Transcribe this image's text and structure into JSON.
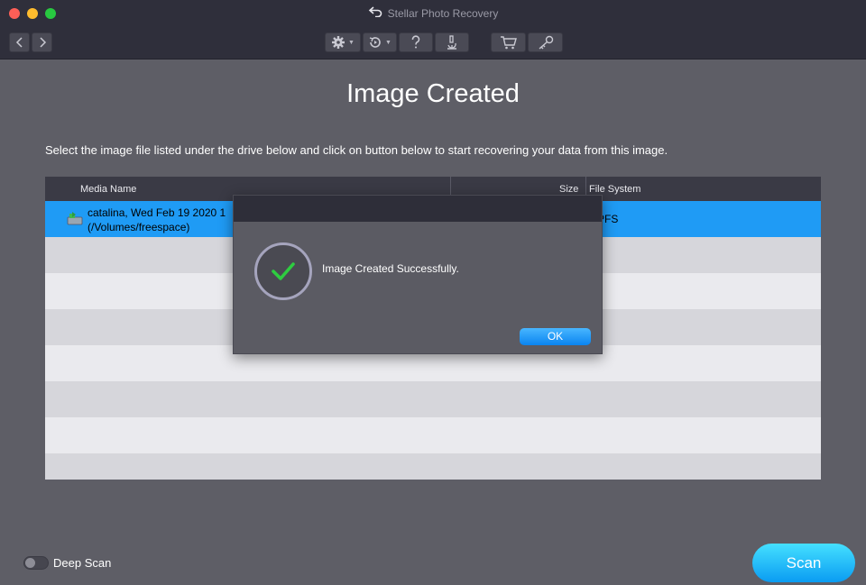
{
  "window": {
    "title": "Stellar Photo Recovery"
  },
  "toolbar": {
    "nav": [
      "back-arrow-icon",
      "forward-arrow-icon"
    ],
    "tools": [
      "gear-icon",
      "history-icon",
      "help-icon",
      "microscope-icon"
    ],
    "store": [
      "cart-icon",
      "key-icon"
    ]
  },
  "page": {
    "title": "Image Created",
    "instruction": "Select the image file listed under the drive below and click on button below to start recovering your data from this image."
  },
  "table": {
    "headers": {
      "media_name": "Media Name",
      "size": "Size",
      "file_system": "File System"
    },
    "rows": [
      {
        "name_line1": "catalina, Wed Feb 19 2020 1",
        "name_line2": "(/Volumes/freespace)",
        "file_system": "PFS",
        "selected": true
      }
    ]
  },
  "dialog": {
    "message": "Image Created Successfully.",
    "ok_label": "OK"
  },
  "footer": {
    "deep_scan_label": "Deep Scan",
    "deep_scan_on": false,
    "scan_label": "Scan"
  },
  "colors": {
    "accent": "#1f9bf5",
    "success": "#2ecc40",
    "scan_button": "#17b8f8"
  }
}
